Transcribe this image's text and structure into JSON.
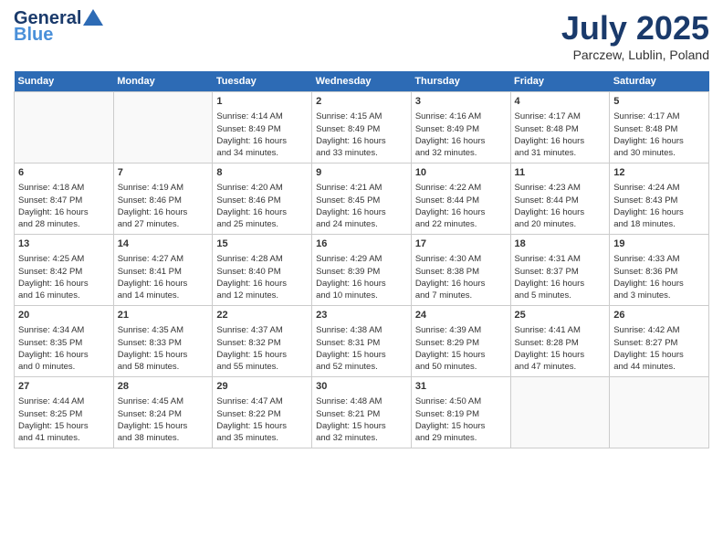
{
  "header": {
    "logo_general": "General",
    "logo_blue": "Blue",
    "month": "July 2025",
    "location": "Parczew, Lublin, Poland"
  },
  "weekdays": [
    "Sunday",
    "Monday",
    "Tuesday",
    "Wednesday",
    "Thursday",
    "Friday",
    "Saturday"
  ],
  "weeks": [
    [
      {
        "day": "",
        "data": ""
      },
      {
        "day": "",
        "data": ""
      },
      {
        "day": "1",
        "data": "Sunrise: 4:14 AM\nSunset: 8:49 PM\nDaylight: 16 hours\nand 34 minutes."
      },
      {
        "day": "2",
        "data": "Sunrise: 4:15 AM\nSunset: 8:49 PM\nDaylight: 16 hours\nand 33 minutes."
      },
      {
        "day": "3",
        "data": "Sunrise: 4:16 AM\nSunset: 8:49 PM\nDaylight: 16 hours\nand 32 minutes."
      },
      {
        "day": "4",
        "data": "Sunrise: 4:17 AM\nSunset: 8:48 PM\nDaylight: 16 hours\nand 31 minutes."
      },
      {
        "day": "5",
        "data": "Sunrise: 4:17 AM\nSunset: 8:48 PM\nDaylight: 16 hours\nand 30 minutes."
      }
    ],
    [
      {
        "day": "6",
        "data": "Sunrise: 4:18 AM\nSunset: 8:47 PM\nDaylight: 16 hours\nand 28 minutes."
      },
      {
        "day": "7",
        "data": "Sunrise: 4:19 AM\nSunset: 8:46 PM\nDaylight: 16 hours\nand 27 minutes."
      },
      {
        "day": "8",
        "data": "Sunrise: 4:20 AM\nSunset: 8:46 PM\nDaylight: 16 hours\nand 25 minutes."
      },
      {
        "day": "9",
        "data": "Sunrise: 4:21 AM\nSunset: 8:45 PM\nDaylight: 16 hours\nand 24 minutes."
      },
      {
        "day": "10",
        "data": "Sunrise: 4:22 AM\nSunset: 8:44 PM\nDaylight: 16 hours\nand 22 minutes."
      },
      {
        "day": "11",
        "data": "Sunrise: 4:23 AM\nSunset: 8:44 PM\nDaylight: 16 hours\nand 20 minutes."
      },
      {
        "day": "12",
        "data": "Sunrise: 4:24 AM\nSunset: 8:43 PM\nDaylight: 16 hours\nand 18 minutes."
      }
    ],
    [
      {
        "day": "13",
        "data": "Sunrise: 4:25 AM\nSunset: 8:42 PM\nDaylight: 16 hours\nand 16 minutes."
      },
      {
        "day": "14",
        "data": "Sunrise: 4:27 AM\nSunset: 8:41 PM\nDaylight: 16 hours\nand 14 minutes."
      },
      {
        "day": "15",
        "data": "Sunrise: 4:28 AM\nSunset: 8:40 PM\nDaylight: 16 hours\nand 12 minutes."
      },
      {
        "day": "16",
        "data": "Sunrise: 4:29 AM\nSunset: 8:39 PM\nDaylight: 16 hours\nand 10 minutes."
      },
      {
        "day": "17",
        "data": "Sunrise: 4:30 AM\nSunset: 8:38 PM\nDaylight: 16 hours\nand 7 minutes."
      },
      {
        "day": "18",
        "data": "Sunrise: 4:31 AM\nSunset: 8:37 PM\nDaylight: 16 hours\nand 5 minutes."
      },
      {
        "day": "19",
        "data": "Sunrise: 4:33 AM\nSunset: 8:36 PM\nDaylight: 16 hours\nand 3 minutes."
      }
    ],
    [
      {
        "day": "20",
        "data": "Sunrise: 4:34 AM\nSunset: 8:35 PM\nDaylight: 16 hours\nand 0 minutes."
      },
      {
        "day": "21",
        "data": "Sunrise: 4:35 AM\nSunset: 8:33 PM\nDaylight: 15 hours\nand 58 minutes."
      },
      {
        "day": "22",
        "data": "Sunrise: 4:37 AM\nSunset: 8:32 PM\nDaylight: 15 hours\nand 55 minutes."
      },
      {
        "day": "23",
        "data": "Sunrise: 4:38 AM\nSunset: 8:31 PM\nDaylight: 15 hours\nand 52 minutes."
      },
      {
        "day": "24",
        "data": "Sunrise: 4:39 AM\nSunset: 8:29 PM\nDaylight: 15 hours\nand 50 minutes."
      },
      {
        "day": "25",
        "data": "Sunrise: 4:41 AM\nSunset: 8:28 PM\nDaylight: 15 hours\nand 47 minutes."
      },
      {
        "day": "26",
        "data": "Sunrise: 4:42 AM\nSunset: 8:27 PM\nDaylight: 15 hours\nand 44 minutes."
      }
    ],
    [
      {
        "day": "27",
        "data": "Sunrise: 4:44 AM\nSunset: 8:25 PM\nDaylight: 15 hours\nand 41 minutes."
      },
      {
        "day": "28",
        "data": "Sunrise: 4:45 AM\nSunset: 8:24 PM\nDaylight: 15 hours\nand 38 minutes."
      },
      {
        "day": "29",
        "data": "Sunrise: 4:47 AM\nSunset: 8:22 PM\nDaylight: 15 hours\nand 35 minutes."
      },
      {
        "day": "30",
        "data": "Sunrise: 4:48 AM\nSunset: 8:21 PM\nDaylight: 15 hours\nand 32 minutes."
      },
      {
        "day": "31",
        "data": "Sunrise: 4:50 AM\nSunset: 8:19 PM\nDaylight: 15 hours\nand 29 minutes."
      },
      {
        "day": "",
        "data": ""
      },
      {
        "day": "",
        "data": ""
      }
    ]
  ]
}
